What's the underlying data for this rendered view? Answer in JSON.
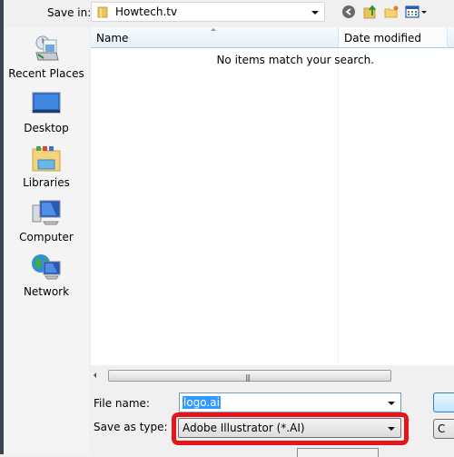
{
  "save_in": {
    "label": "Save in:",
    "value": "Howtech.tv"
  },
  "toolbar": {
    "icons": [
      "back-icon",
      "up-folder-icon",
      "new-folder-icon",
      "view-menu-icon"
    ]
  },
  "places": [
    {
      "label": "Recent Places",
      "icon": "recent-places-icon"
    },
    {
      "label": "Desktop",
      "icon": "desktop-icon"
    },
    {
      "label": "Libraries",
      "icon": "libraries-icon"
    },
    {
      "label": "Computer",
      "icon": "computer-icon"
    },
    {
      "label": "Network",
      "icon": "network-icon"
    }
  ],
  "file_list": {
    "columns": [
      "Name",
      "Date modified"
    ],
    "empty_message": "No items match your search."
  },
  "file_name": {
    "label": "File name:",
    "value": "logo.ai"
  },
  "save_as_type": {
    "label": "Save as type:",
    "value": "Adobe Illustrator (*.AI)"
  },
  "buttons": {
    "cancel_partial": "C"
  },
  "colors": {
    "highlight": "#e8141b",
    "selection": "#3399ff"
  }
}
